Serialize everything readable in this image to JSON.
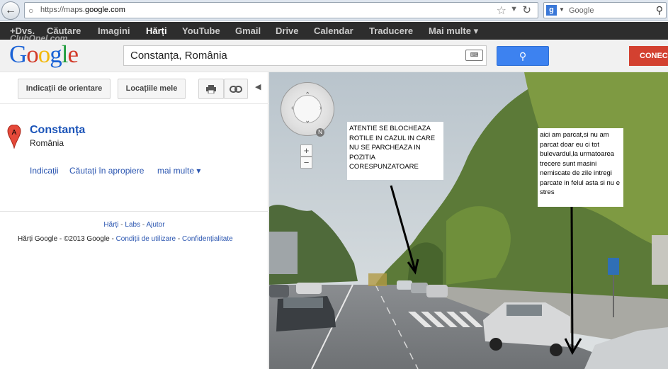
{
  "browser": {
    "url_prefix": "https://maps.",
    "url_domain": "google.com",
    "search_engine": "Google"
  },
  "gbar": {
    "items": [
      "+Dvs.",
      "Căutare",
      "Imagini",
      "Hărți",
      "YouTube",
      "Gmail",
      "Drive",
      "Calendar",
      "Traducere",
      "Mai multe ▾"
    ],
    "active": "Hărți",
    "watermark": "ClubOpel.com"
  },
  "header": {
    "logo": "Google",
    "query": "Constanța, România",
    "connect_label": "CONECT"
  },
  "left_panel": {
    "directions_btn": "Indicații de orientare",
    "my_places_btn": "Locațiile mele",
    "marker_letter": "A",
    "place_name": "Constanța",
    "place_country": "România",
    "links": {
      "directions": "Indicații",
      "nearby": "Căutați în apropiere",
      "more": "mai multe ▾"
    },
    "footer_links": [
      "Hărți",
      "Labs",
      "Ajutor"
    ],
    "copyright": "Hărți Google - ©2013 Google - ",
    "terms": "Condiții de utilizare",
    "privacy": "Confidențialitate"
  },
  "street_view": {
    "compass_label": "N",
    "note_1": "ATENTIE SE BLOCHEAZA ROTILE IN CAZUL IN CARE NU SE PARCHEAZA IN POZITIA CORESPUNZATOARE",
    "note_2": "aici am parcat,si nu am parcat doar eu ci tot bulevardul,la urmatoarea trecere sunt masini nemiscate de zile intregi parcate in felul asta si nu e stres"
  }
}
